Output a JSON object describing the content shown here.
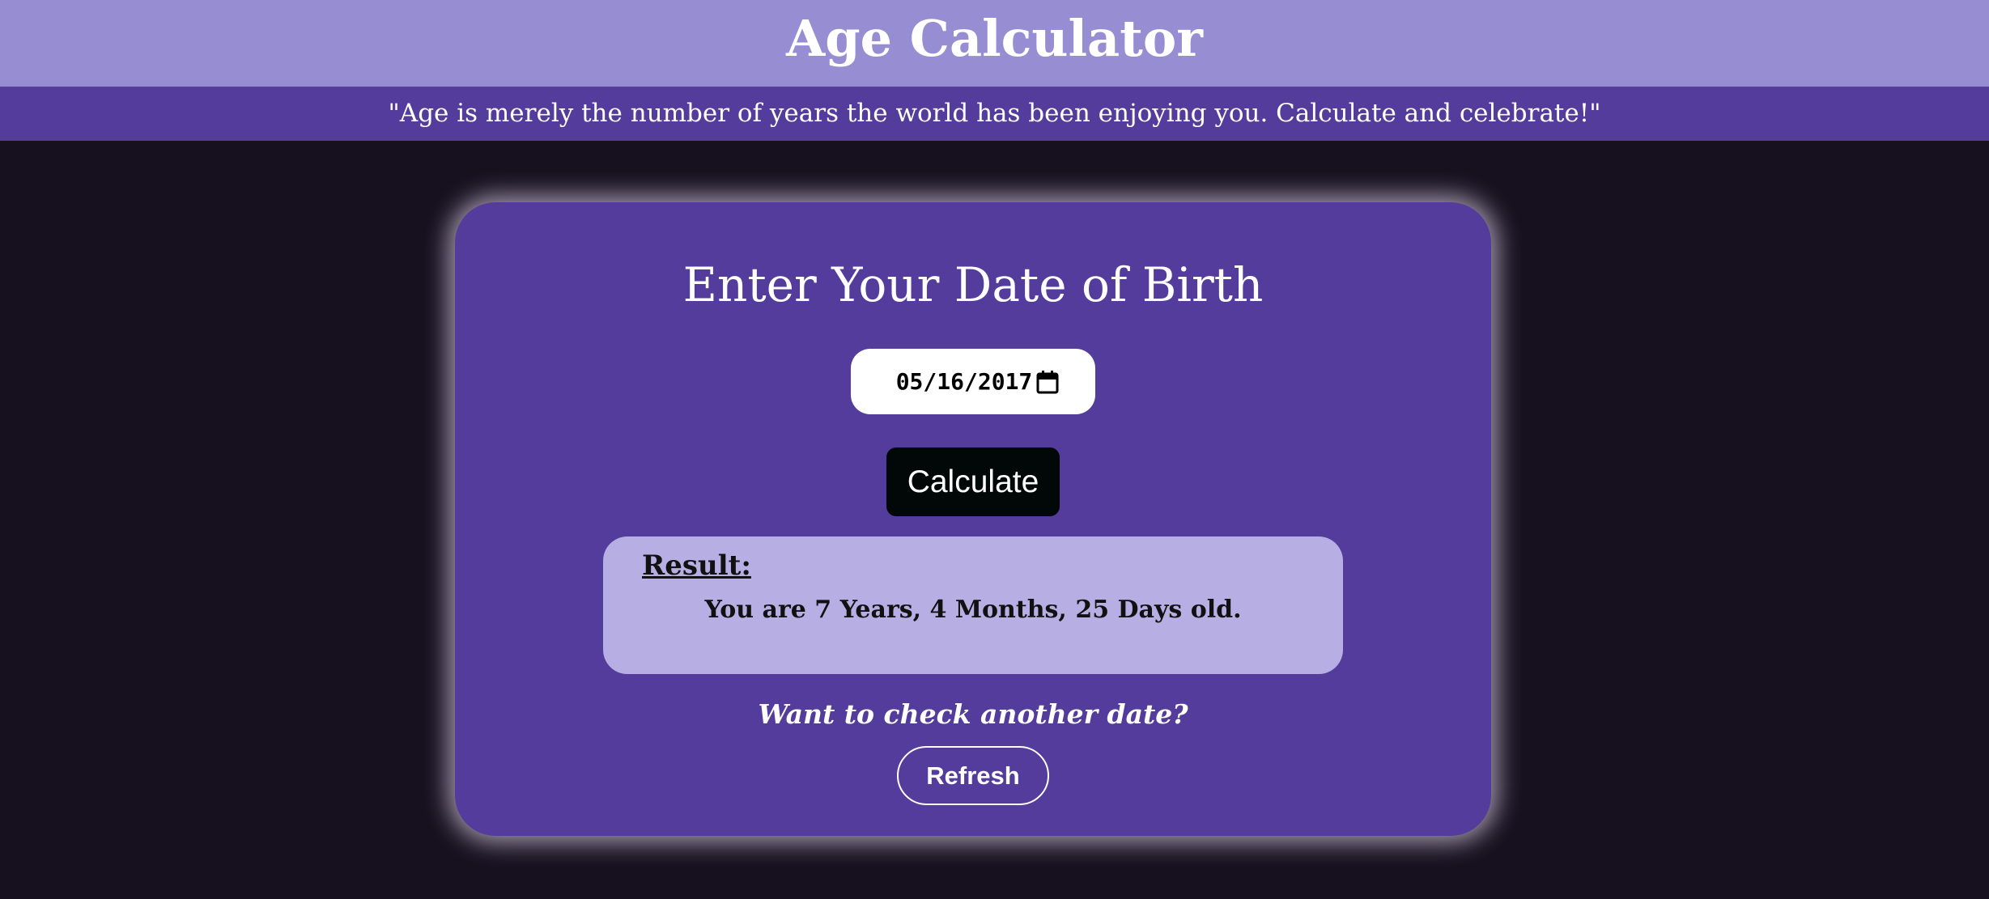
{
  "header": {
    "title": "Age Calculator",
    "quote": "\"Age is merely the number of years the world has been enjoying you. Calculate and celebrate!\""
  },
  "card": {
    "title": "Enter Your Date of Birth",
    "date_input": {
      "value": "05/16/2017",
      "icon": "calendar-icon"
    },
    "calculate_label": "Calculate",
    "result": {
      "label": "Result:",
      "text": "You are 7 Years, 4 Months, 25 Days old."
    },
    "prompt": "Want to check another date?",
    "refresh_label": "Refresh"
  },
  "colors": {
    "page_background": "#17101f",
    "header_background": "#978dd2",
    "quote_bar_background": "#543c9c",
    "card_background": "#543c9c",
    "result_background": "#b7aee4",
    "calculate_button_background": "#020807",
    "text_light": "#ffffff"
  }
}
